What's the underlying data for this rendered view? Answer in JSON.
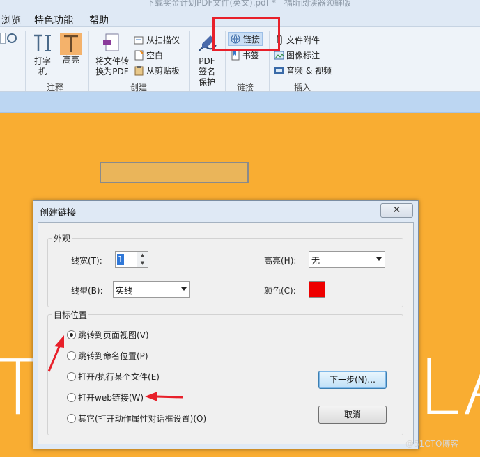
{
  "window": {
    "title": "下载奖金计划PDF文件(英文).pdf * - 福昕阅读器领鲜版"
  },
  "menu": {
    "browse": "浏览",
    "features": "特色功能",
    "help": "帮助"
  },
  "ribbon": {
    "typewriter": "打字机",
    "highlight": "高亮",
    "annotate_group": "注释",
    "convert_to_pdf": "将文件转换为PDF",
    "from_scanner": "从扫描仪",
    "blank": "空白",
    "from_clipboard": "从剪贴板",
    "create_group": "创建",
    "pdf_sign": "PDF签名保护",
    "link": "链接",
    "bookmark": "书签",
    "link_group": "链接",
    "file_attachment": "文件附件",
    "image_annotation": "图像标注",
    "audio_video": "音频 & 视频",
    "insert_group": "插入"
  },
  "dialog": {
    "title": "创建链接",
    "appearance": {
      "legend": "外观",
      "line_width_label": "线宽(T):",
      "line_width_value": "1",
      "highlight_label": "高亮(H):",
      "highlight_value": "无",
      "line_style_label": "线型(B):",
      "line_style_value": "实线",
      "color_label": "颜色(C):",
      "color_value": "#ee0000"
    },
    "target": {
      "legend": "目标位置",
      "options": [
        "跳转到页面视图(V)",
        "跳转到命名位置(P)",
        "打开/执行某个文件(E)",
        "打开web链接(W)",
        "其它(打开动作属性对话框设置)(O)"
      ],
      "selected_index": 0
    },
    "next_button": "下一步(N)...",
    "cancel_button": "取消"
  },
  "watermark": "@51CTO博客",
  "colors": {
    "annotation_red": "#e8202a",
    "document_bg": "#f9ad32"
  }
}
